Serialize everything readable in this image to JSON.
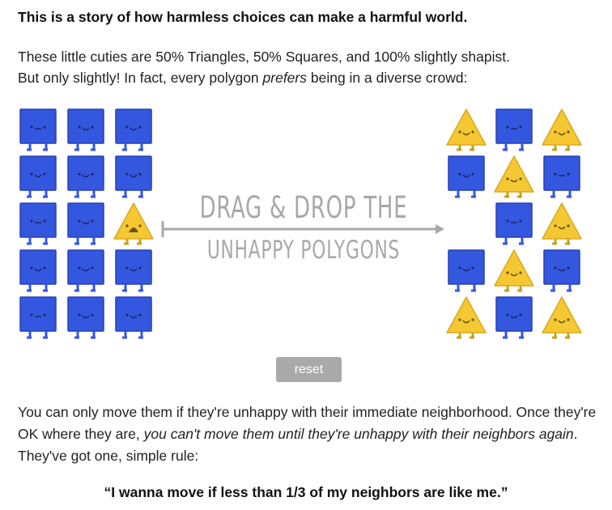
{
  "headline": "This is a story of how harmless choices can make a harmful world.",
  "intro": {
    "line1": "These little cuties are 50% Triangles, 50% Squares, and 100% slightly shapist.",
    "line2_pre": "But only slightly! In fact, every polygon ",
    "line2_em": "prefers",
    "line2_post": " being in a diverse crowd:"
  },
  "drag_label": {
    "line1": "DRAG & DROP THE",
    "line2": "UNHAPPY POLYGONS"
  },
  "reset_label": "reset",
  "rule_intro": {
    "pre": "You can only move them if they're unhappy with their immediate neighborhood. Once they're OK where they are, ",
    "em": "you can't move them until they're unhappy with their neighbors again",
    "post": ". They've got one, simple rule:"
  },
  "rule_quote": "“I wanna move if less than 1/3 of my neighbors are like me.”",
  "colors": {
    "square": "#3457e0",
    "triangle": "#f5c732",
    "label": "#a8a8a8"
  },
  "grids": {
    "left": [
      [
        "square-meh",
        "square-happy",
        "square-happy"
      ],
      [
        "square-happy",
        "square-happy",
        "square-happy"
      ],
      [
        "square-meh",
        "square-happy",
        "triangle-sad"
      ],
      [
        "square-happy",
        "square-happy",
        "square-happy"
      ],
      [
        "square-meh",
        "square-happy",
        "square-happy"
      ]
    ],
    "right": [
      [
        "triangle-happy",
        "square-meh",
        "triangle-happy"
      ],
      [
        "square-happy",
        "triangle-happy",
        "square-meh"
      ],
      [
        "empty",
        "square-meh",
        "triangle-happy"
      ],
      [
        "square-happy",
        "triangle-happy",
        "square-happy"
      ],
      [
        "triangle-happy",
        "square-happy",
        "triangle-happy"
      ]
    ]
  }
}
